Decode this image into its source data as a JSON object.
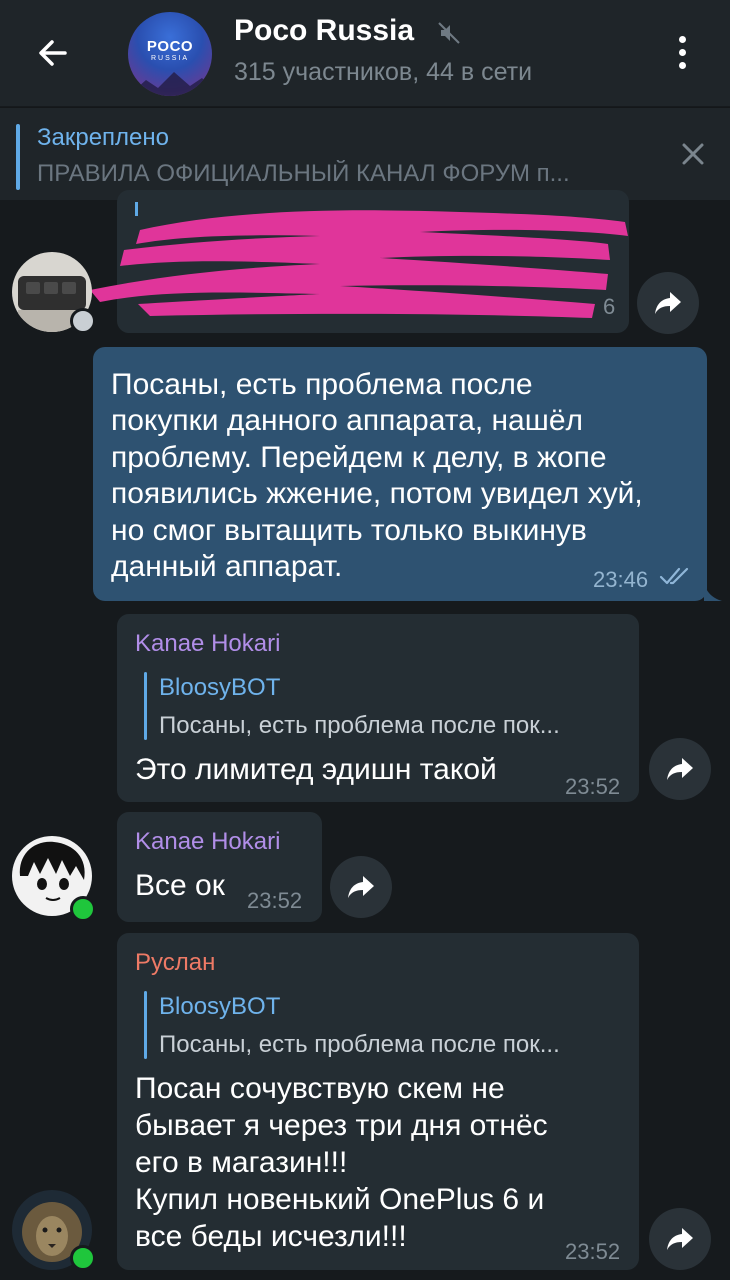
{
  "header": {
    "title": "Poco Russia",
    "subtitle": "315 участников, 44 в сети",
    "avatar_big": "POCO",
    "avatar_small": "RUSSIA"
  },
  "pinned": {
    "title": "Закреплено",
    "text": "ПРАВИЛА ОФИЦИАЛЬНЫЙ КАНАЛ ФОРУМ п..."
  },
  "messages": [
    {
      "kind": "redacted",
      "time_fragment": "6"
    },
    {
      "kind": "own",
      "text": "Посаны, есть проблема после покупки данного аппарата, нашёл проблему. Перейдем к делу, в жопе появились жжение, потом увидел хуй, но смог вытащить только выкинув данный аппарат.",
      "lines": [
        "Посаны, есть проблема после",
        "покупки данного аппарата, нашёл",
        "проблему. Перейдем к делу, в жопе",
        "появились жжение, потом увидел хуй,",
        "но смог вытащить только выкинув",
        "данный аппарат."
      ],
      "time": "23:46"
    },
    {
      "kind": "reply",
      "sender": "Kanae Hokari",
      "reply_to": "BloosyBOT",
      "reply_text": "Посаны, есть проблема после пок...",
      "text": "Это лимитед эдишн такой",
      "time": "23:52"
    },
    {
      "kind": "plain",
      "sender": "Kanae Hokari",
      "text": "Все ок",
      "time": "23:52"
    },
    {
      "kind": "reply",
      "sender": "Руслан",
      "reply_to": "BloosyBOT",
      "reply_text": "Посаны, есть проблема после пок...",
      "text": "Посан сочувствую скем не бывает я через три дня отнёс его в магазин!!! Купил новенький OnePlus 6 и все беды исчезли!!!",
      "lines": [
        "Посан сочувствую скем не",
        "бывает я через три дня отнёс",
        "его в магазин!!!",
        "Купил новенький OnePlus 6 и",
        "все беды исчезли!!!"
      ],
      "time": "23:52"
    }
  ],
  "colors": {
    "background": "#161a1d",
    "header": "#1f2529",
    "incoming_bubble": "#242d33",
    "outgoing_bubble": "#2e5271",
    "accent": "#6fb3ec",
    "sender_kanae": "#b18ee8",
    "sender_ruslan": "#ee7a66",
    "online": "#1fc63c",
    "redaction": "#e0359a"
  },
  "icons": {
    "back": "arrow-left-icon",
    "mute": "muted-icon",
    "menu": "more-vertical-icon",
    "close": "close-icon",
    "share": "forward-share-icon",
    "read": "double-check-icon"
  }
}
